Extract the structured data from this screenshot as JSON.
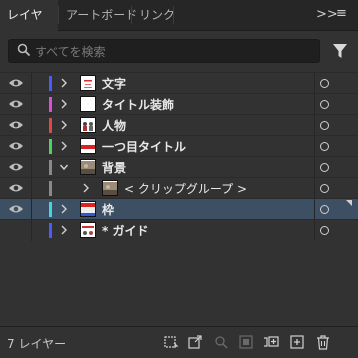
{
  "tabs": [
    {
      "label": "レイヤー",
      "active": true
    },
    {
      "label": "アートボード",
      "active": false
    },
    {
      "label": "リンク",
      "active": false
    }
  ],
  "tab_controls": {
    "collapse": ">>",
    "menu": "≡"
  },
  "search": {
    "placeholder": "すべてを検索"
  },
  "layers": [
    {
      "name": "文字",
      "color": "#4a5cff",
      "expanded": false,
      "thumb": "text"
    },
    {
      "name": "タイトル装飾",
      "color": "#e14bd9",
      "expanded": false,
      "thumb": "blank"
    },
    {
      "name": "人物",
      "color": "#e04848",
      "expanded": false,
      "thumb": "people"
    },
    {
      "name": "一つ目タイトル",
      "color": "#4bd65a",
      "expanded": false,
      "thumb": "title"
    },
    {
      "name": "背景",
      "color": "#8a8a8a",
      "expanded": true,
      "thumb": "bg"
    },
    {
      "name": "< クリップグループ >",
      "color": "#8a8a8a",
      "expanded": false,
      "thumb": "bg",
      "sublayer": true
    },
    {
      "name": "枠",
      "color": "#3fd6e6",
      "expanded": false,
      "thumb": "frame",
      "selected": true
    },
    {
      "name": "* ガイド",
      "color": "#4a5cff",
      "expanded": false,
      "thumb": "guide",
      "no_eye": true
    }
  ],
  "footer": {
    "count_label": "7 レイヤー"
  },
  "icons": [
    "eye-icon",
    "search-icon",
    "filter-icon",
    "chevron-right-icon",
    "chevron-down-icon",
    "target-circle-icon",
    "collect-for-export-icon",
    "export-icon",
    "locate-object-icon",
    "make-clipping-mask-icon",
    "new-sublayer-icon",
    "new-layer-icon",
    "trash-icon"
  ]
}
